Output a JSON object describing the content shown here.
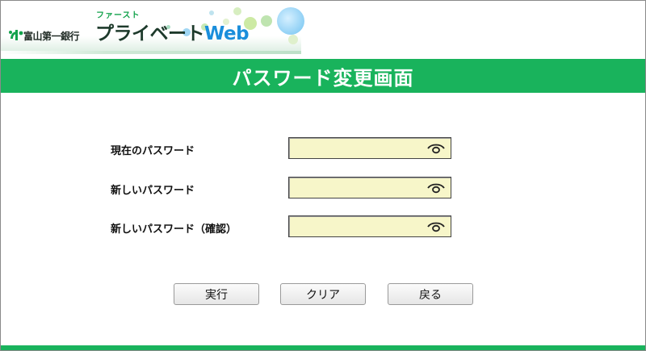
{
  "header": {
    "bank_name": "富山第一銀行",
    "service_ruby": "ファースト",
    "service_name_main": "プライベート",
    "service_name_web": "Web",
    "brand_color": "#19b35c",
    "web_color": "#1a8edb"
  },
  "page": {
    "title": "パスワード変更画面"
  },
  "form": {
    "fields": [
      {
        "label": "現在のパスワード",
        "value": "",
        "icon": "eye-icon"
      },
      {
        "label": "新しいパスワード",
        "value": "",
        "icon": "eye-icon"
      },
      {
        "label": "新しいパスワード（確認）",
        "value": "",
        "icon": "eye-icon"
      }
    ],
    "field_background": "#f7f6c9"
  },
  "buttons": {
    "execute": "実行",
    "clear": "クリア",
    "back": "戻る"
  }
}
